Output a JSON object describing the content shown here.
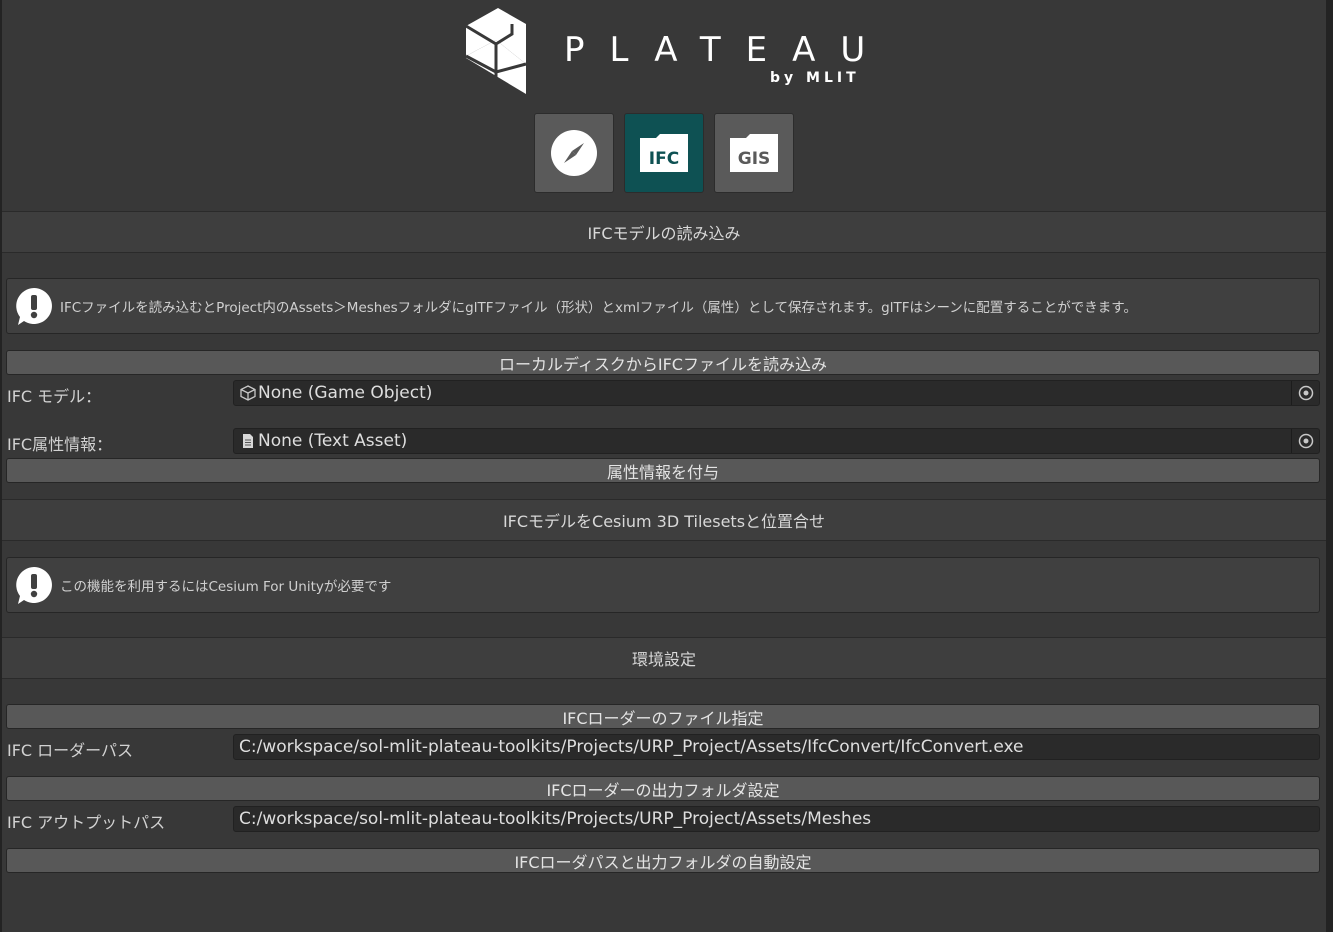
{
  "logo": {
    "wordmark": "PLATEAU",
    "byline": "by MLIT"
  },
  "modes": [
    {
      "name": "compass",
      "icon": "compass-icon",
      "label": ""
    },
    {
      "name": "ifc",
      "icon": "ifc-folder-icon",
      "label": "IFC",
      "active": true
    },
    {
      "name": "gis",
      "icon": "gis-folder-icon",
      "label": "GIS"
    }
  ],
  "sections": {
    "ifc_import": {
      "title": "IFCモデルの読み込み",
      "help": "IFCファイルを読み込むとProject内のAssets＞Meshesフォルダにglf TFファイル（形状）とxmlファイル（属性）として保存されます。glTFはシーンに配置することができます。",
      "load_button": "ローカルディスクからIFCファイルを読み込み",
      "model_label": "IFC モデル：",
      "model_value": "None (Game Object)",
      "attr_label": "IFC属性情報：",
      "attr_value": "None (Text Asset)",
      "attach_button": "属性情報を付与"
    },
    "cesium": {
      "title": "IFCモデルをCesium 3D Tilesetsと位置合せ",
      "help": "この機能を利用するにはCesium For Unityが必要です"
    },
    "env": {
      "title": "環境設定",
      "loader_file_button": "IFCローダーのファイル指定",
      "loader_path_label": "IFC ローダーパス",
      "loader_path_value": "C:/workspace/sol-mlit-plateau-toolkits/Projects/URP_Project/Assets/IfcConvert/IfcConvert.exe",
      "output_folder_button": "IFCローダーの出力フォルダ設定",
      "output_path_label": "IFC アウトプットパス",
      "output_path_value": "C:/workspace/sol-mlit-plateau-toolkits/Projects/URP_Project/Assets/Meshes",
      "auto_button": "IFCローダパスと出力フォルダの自動設定"
    }
  },
  "colors": {
    "background": "#383838",
    "active_mode": "#0e5153",
    "button": "#585858",
    "field": "#2a2a2a"
  }
}
